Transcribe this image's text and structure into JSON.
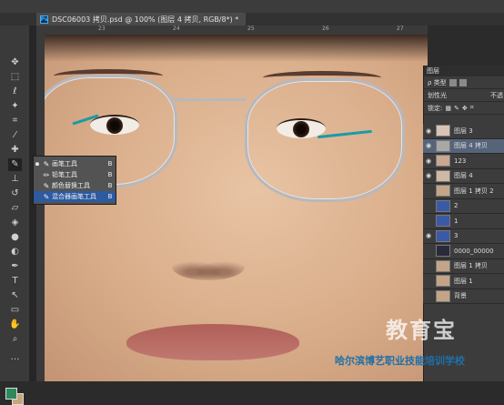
{
  "document_tab": {
    "title": "DSC06003 拷贝.psd @ 100% (图层 4 拷贝, RGB/8*) *",
    "app_logo": "Ps"
  },
  "ruler": {
    "ticks": [
      "23",
      "24",
      "25",
      "26",
      "27"
    ]
  },
  "tool_flyout": {
    "items": [
      {
        "label": "画笔工具",
        "shortcut": "B",
        "selected": false,
        "current": true
      },
      {
        "label": "铅笔工具",
        "shortcut": "B",
        "selected": false,
        "current": false
      },
      {
        "label": "颜色替换工具",
        "shortcut": "B",
        "selected": false,
        "current": false
      },
      {
        "label": "混合器画笔工具",
        "shortcut": "B",
        "selected": true,
        "current": false
      }
    ]
  },
  "layers_panel": {
    "title": "图层",
    "filter_label": "ρ 类型",
    "blend_mode": "划性光",
    "opacity_label": "不透",
    "lock_label": "锁定:",
    "layers": [
      {
        "name": "图层 3",
        "visible": true,
        "selected": false,
        "thumb": "#d8c4b4"
      },
      {
        "name": "图层 4 拷贝",
        "visible": true,
        "selected": true,
        "thumb": "#a8a8a8"
      },
      {
        "name": "123",
        "visible": true,
        "selected": false,
        "thumb": "#c8a890"
      },
      {
        "name": "图层 4",
        "visible": true,
        "selected": false,
        "thumb": "#d0b8a4"
      },
      {
        "name": "图层 1 拷贝 2",
        "visible": false,
        "selected": false,
        "thumb": "#c4a488"
      },
      {
        "name": "2",
        "visible": false,
        "selected": false,
        "thumb": "#3a5aa8"
      },
      {
        "name": "1",
        "visible": false,
        "selected": false,
        "thumb": "#3a5aa8"
      },
      {
        "name": "3",
        "visible": true,
        "selected": false,
        "thumb": "#3a5aa8"
      },
      {
        "name": "0000_00000",
        "visible": false,
        "selected": false,
        "thumb": "#2a2a3a"
      },
      {
        "name": "图层 1 拷贝",
        "visible": false,
        "selected": false,
        "thumb": "#c4a488"
      },
      {
        "name": "图层 1",
        "visible": false,
        "selected": false,
        "thumb": "#c4a488"
      },
      {
        "name": "背景",
        "visible": false,
        "selected": false,
        "thumb": "#c4a488"
      }
    ]
  },
  "watermark": {
    "logo_text": "教育宝",
    "caption": "哈尔滨博艺职业技能培训学校"
  }
}
